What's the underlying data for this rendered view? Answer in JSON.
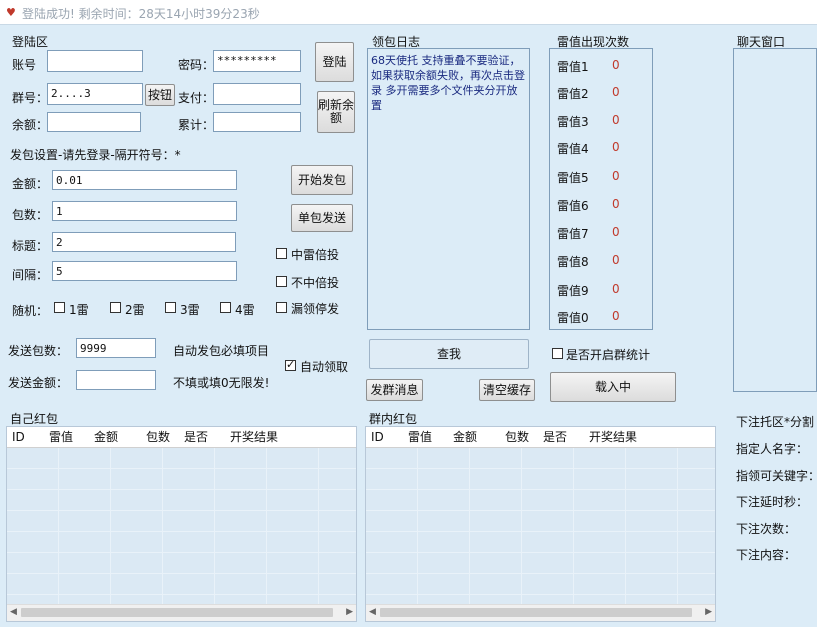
{
  "titlebar": {
    "text": "登陆成功! 剩余时间：28天14小时39分23秒"
  },
  "login": {
    "section": "登陆区",
    "account_label": "账号",
    "account_value": "",
    "password_label": "密码：",
    "password_value": "*********",
    "login_btn": "登陆",
    "group_label": "群号：",
    "group_value": "2....3",
    "group_btn": "按钮",
    "pay_label": "支付：",
    "pay_value": "",
    "refresh_btn": "刷新余额",
    "balance_label": "余额：",
    "balance_value": "",
    "total_label": "累计：",
    "total_value": ""
  },
  "send": {
    "section": "发包设置-请先登录-隔开符号：*",
    "amount_label": "金额：",
    "amount_value": "0.01",
    "count_label": "包数：",
    "count_value": "1",
    "title_label": "标题：",
    "title_value": "2",
    "interval_label": "间隔：",
    "interval_value": "5",
    "start_btn": "开始发包",
    "single_btn": "单包发送",
    "chk_hit_double": "中雷倍投",
    "chk_miss_double": "不中倍投",
    "chk_miss_stop": "漏领停发",
    "random_label": "随机：",
    "random_opts": [
      "1雷",
      "2雷",
      "3雷",
      "4雷"
    ],
    "send_count_label": "发送包数：",
    "send_count_value": "9999",
    "required_note": "自动发包必填项目",
    "auto_receive": "自动领取",
    "send_amount_label": "发送金额：",
    "send_amount_value": "",
    "no_limit_note": "不填或填0无限发!"
  },
  "log": {
    "section": "领包日志",
    "text": "68天使托 支持重叠不要验证，如果获取余额失败，再次点击登录      多开需要多个文件夹分开放置",
    "query_btn": "查我",
    "send_msg_btn": "发群消息",
    "clear_btn": "清空缓存"
  },
  "lei": {
    "section": "雷值出现次数",
    "rows": [
      {
        "name": "雷值1",
        "value": "0"
      },
      {
        "name": "雷值2",
        "value": "0"
      },
      {
        "name": "雷值3",
        "value": "0"
      },
      {
        "name": "雷值4",
        "value": "0"
      },
      {
        "name": "雷值5",
        "value": "0"
      },
      {
        "name": "雷值6",
        "value": "0"
      },
      {
        "name": "雷值7",
        "value": "0"
      },
      {
        "name": "雷值8",
        "value": "0"
      },
      {
        "name": "雷值9",
        "value": "0"
      },
      {
        "name": "雷值0",
        "value": "0"
      }
    ],
    "stats_chk": "是否开启群统计",
    "loading_btn": "载入中"
  },
  "chat": {
    "section": "聊天窗口",
    "bet_zone": "下注托区*分割",
    "target_name": "指定人名字：",
    "keyword": "指领可关键字：",
    "delay": "下注延时秒：",
    "times": "下注次数：",
    "content": "下注内容："
  },
  "own_packets": {
    "section": "自己红包",
    "columns": [
      "ID",
      "雷值",
      "金额",
      "包数",
      "是否",
      "开奖结果"
    ]
  },
  "group_packets": {
    "section": "群内红包",
    "columns": [
      "ID",
      "雷值",
      "金额",
      "包数",
      "是否",
      "开奖结果"
    ]
  }
}
